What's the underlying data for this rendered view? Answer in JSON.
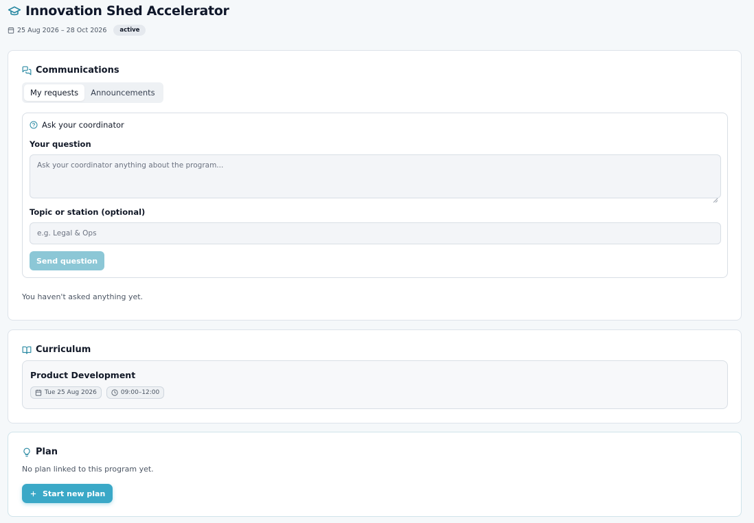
{
  "header": {
    "title": "Innovation Shed Accelerator",
    "dates": "25 Aug 2026 – 28 Oct 2026",
    "status": "active"
  },
  "communications": {
    "title": "Communications",
    "tabs": [
      {
        "label": "My requests",
        "active": true
      },
      {
        "label": "Announcements",
        "active": false
      }
    ],
    "ask": {
      "title": "Ask your coordinator",
      "question_label": "Your question",
      "question_placeholder": "Ask your coordinator anything about the program...",
      "topic_label": "Topic or station (optional)",
      "topic_placeholder": "e.g. Legal & Ops",
      "send_label": "Send question"
    },
    "empty_text": "You haven't asked anything yet."
  },
  "curriculum": {
    "title": "Curriculum",
    "sessions": [
      {
        "title": "Product Development",
        "date": "Tue 25 Aug 2026",
        "time": "09:00–12:00"
      }
    ]
  },
  "plan": {
    "title": "Plan",
    "empty_text": "No plan linked to this program yet.",
    "button_label": "Start new plan"
  },
  "colors": {
    "accent": "#3aa8c7",
    "accent_disabled": "#8cc7d6",
    "icon_teal": "#2b8aa3"
  }
}
